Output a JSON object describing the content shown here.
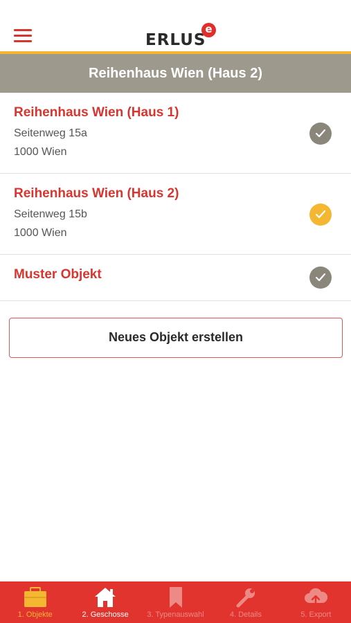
{
  "header": {
    "logo_text": "ERLUS",
    "logo_badge": "e",
    "title": "Reihenhaus Wien (Haus 2)"
  },
  "objects": [
    {
      "title": "Reihenhaus Wien (Haus 1)",
      "street": "Seitenweg 15a",
      "city": "1000 Wien",
      "selected": false
    },
    {
      "title": "Reihenhaus Wien (Haus 2)",
      "street": "Seitenweg 15b",
      "city": "1000 Wien",
      "selected": true
    },
    {
      "title": "Muster Objekt",
      "selected": false
    }
  ],
  "new_object_label": "Neues Objekt erstellen",
  "tabs": [
    {
      "label": "1. Objekte",
      "icon": "briefcase-icon",
      "state": "active"
    },
    {
      "label": "2. Geschosse",
      "icon": "house-icon",
      "state": "enabled"
    },
    {
      "label": "3. Typenauswahl",
      "icon": "bookmark-icon",
      "state": "disabled"
    },
    {
      "label": "4. Details",
      "icon": "wrench-icon",
      "state": "disabled"
    },
    {
      "label": "5. Export",
      "icon": "cloud-upload-icon",
      "state": "disabled"
    }
  ],
  "colors": {
    "brand_red": "#e2342f",
    "accent_yellow": "#f5b731",
    "header_gray": "#9e998d",
    "check_gray": "#8b867a"
  }
}
